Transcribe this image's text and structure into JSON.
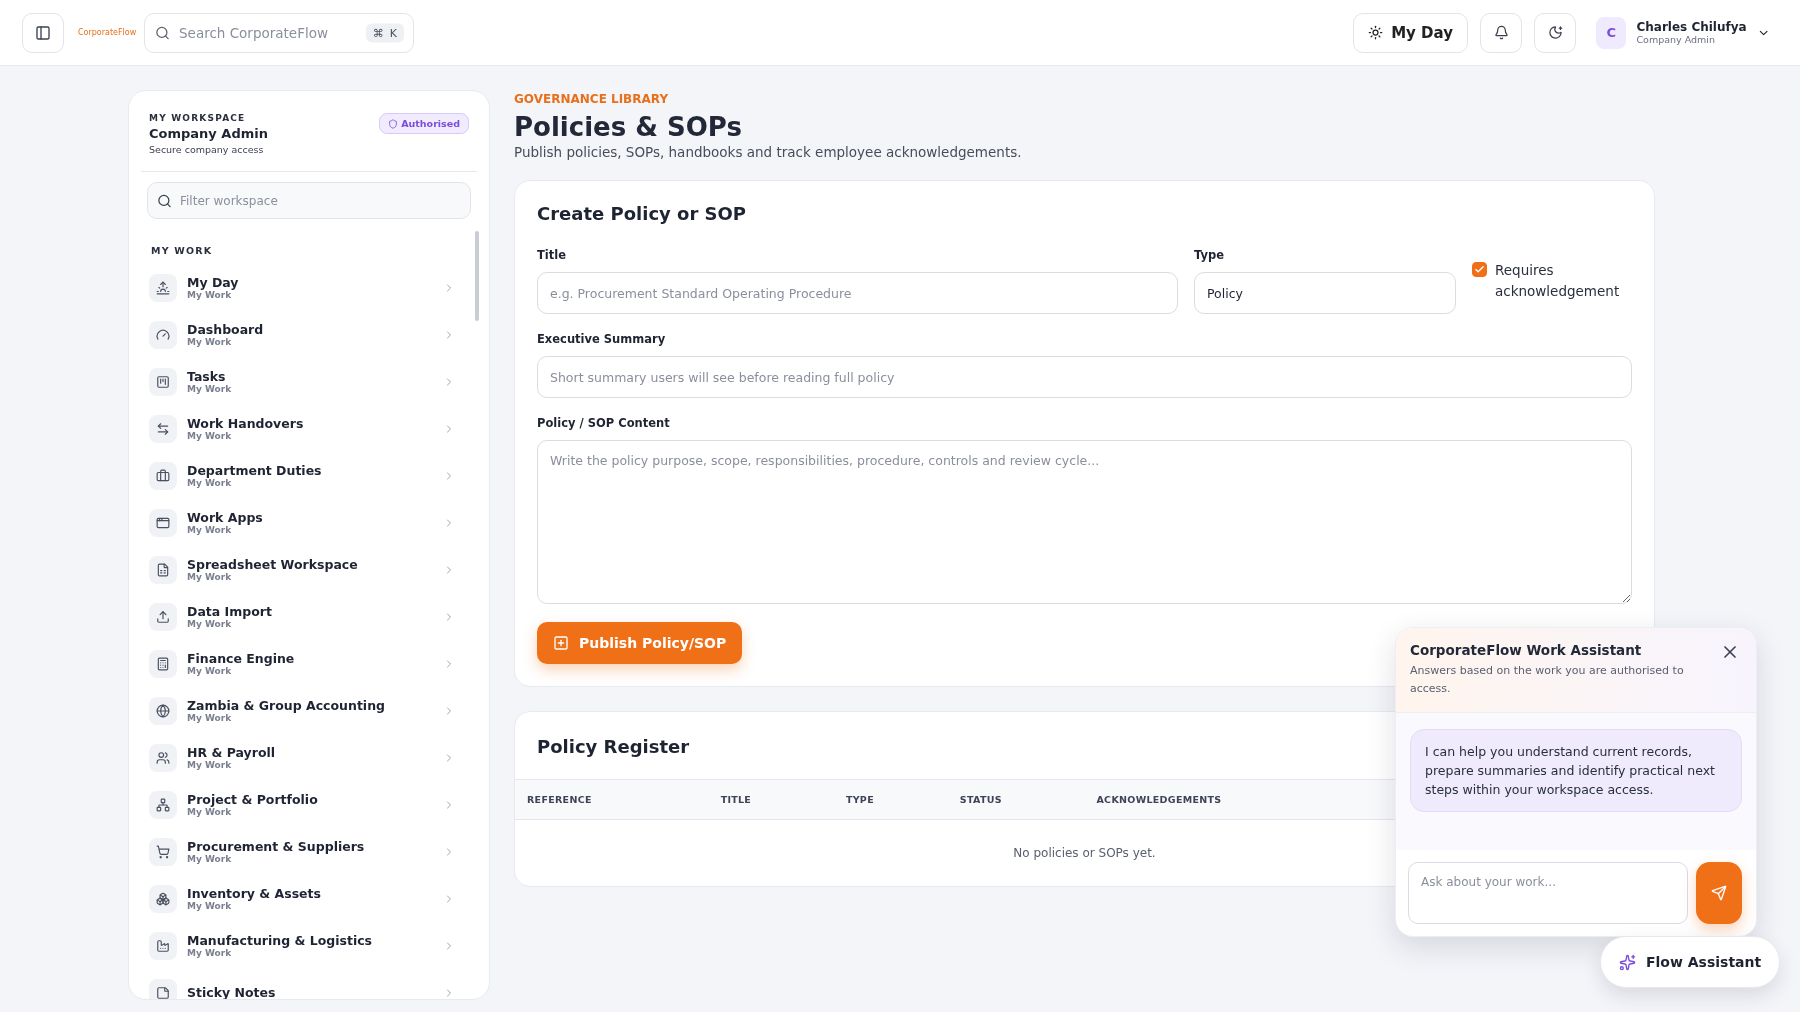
{
  "topbar": {
    "logo_text": "CorporateFlow",
    "search": {
      "placeholder": "Search CorporateFlow",
      "keys": [
        "⌘",
        "K"
      ]
    },
    "my_day_button": "My Day",
    "user": {
      "initial": "C",
      "name": "Charles Chilufya",
      "role": "Company Admin"
    }
  },
  "sidebar": {
    "eyebrow": "MY WORKSPACE",
    "title": "Company Admin",
    "subtitle": "Secure company access",
    "badge": "Authorised",
    "filter": {
      "placeholder": "Filter workspace"
    },
    "section": "MY WORK",
    "items": [
      {
        "label": "My Day",
        "sublabel": "My Work"
      },
      {
        "label": "Dashboard",
        "sublabel": "My Work"
      },
      {
        "label": "Tasks",
        "sublabel": "My Work"
      },
      {
        "label": "Work Handovers",
        "sublabel": "My Work"
      },
      {
        "label": "Department Duties",
        "sublabel": "My Work"
      },
      {
        "label": "Work Apps",
        "sublabel": "My Work"
      },
      {
        "label": "Spreadsheet Workspace",
        "sublabel": "My Work"
      },
      {
        "label": "Data Import",
        "sublabel": "My Work"
      },
      {
        "label": "Finance Engine",
        "sublabel": "My Work"
      },
      {
        "label": "Zambia & Group Accounting",
        "sublabel": "My Work"
      },
      {
        "label": "HR & Payroll",
        "sublabel": "My Work"
      },
      {
        "label": "Project & Portfolio",
        "sublabel": "My Work"
      },
      {
        "label": "Procurement & Suppliers",
        "sublabel": "My Work"
      },
      {
        "label": "Inventory & Assets",
        "sublabel": "My Work"
      },
      {
        "label": "Manufacturing & Logistics",
        "sublabel": "My Work"
      },
      {
        "label": "Sticky Notes"
      }
    ]
  },
  "page": {
    "eyebrow": "GOVERNANCE LIBRARY",
    "title": "Policies & SOPs",
    "subtitle": "Publish policies, SOPs, handbooks and track employee acknowledgements."
  },
  "form": {
    "title": "Create Policy or SOP",
    "title_field": {
      "label": "Title",
      "placeholder": "e.g. Procurement Standard Operating Procedure"
    },
    "type_field": {
      "label": "Type",
      "value": "Policy"
    },
    "acknowledgement": {
      "label": "Requires acknowledgement",
      "checked": true
    },
    "summary_field": {
      "label": "Executive Summary",
      "placeholder": "Short summary users will see before reading full policy"
    },
    "content_field": {
      "label": "Policy / SOP Content",
      "placeholder": "Write the policy purpose, scope, responsibilities, procedure, controls and review cycle..."
    },
    "publish_button": "Publish Policy/SOP"
  },
  "register": {
    "title": "Policy Register",
    "columns": [
      "REFERENCE",
      "TITLE",
      "TYPE",
      "STATUS",
      "ACKNOWLEDGEMENTS"
    ],
    "empty": "No policies or SOPs yet."
  },
  "assistant": {
    "title": "CorporateFlow Work Assistant",
    "subtitle": "Answers based on the work you are authorised to access.",
    "message": "I can help you understand current records, prepare summaries and identify practical next steps within your workspace access.",
    "input": {
      "placeholder": "Ask about your work..."
    },
    "launcher": "Flow Assistant"
  }
}
